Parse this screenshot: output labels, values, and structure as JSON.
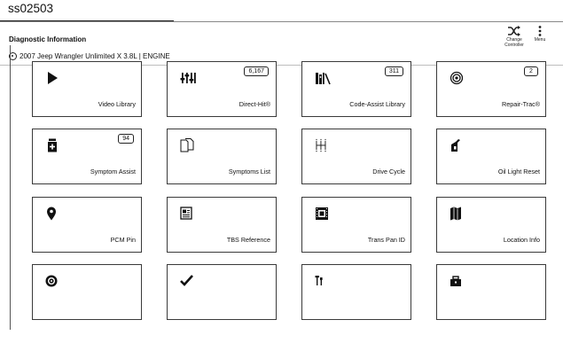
{
  "caption": "ss02503",
  "header": {
    "title": "Diagnostic Information",
    "vehicle": "2007 Jeep Wrangler Unlimited X 3.8L | ENGINE",
    "change_controller_line1": "Change",
    "change_controller_line2": "Controller",
    "menu_label": "Menu"
  },
  "tiles": [
    {
      "label": "Video Library",
      "icon": "play-icon",
      "badge": null
    },
    {
      "label": "Direct-Hit®",
      "icon": "sliders-icon",
      "badge": "6,167"
    },
    {
      "label": "Code-Assist Library",
      "icon": "library-books-icon",
      "badge": "311"
    },
    {
      "label": "Repair-Trac®",
      "icon": "target-icon",
      "badge": "2"
    },
    {
      "label": "Symptom Assist",
      "icon": "medicine-bottle-icon",
      "badge": "94"
    },
    {
      "label": "Symptoms List",
      "icon": "documents-icon",
      "badge": null
    },
    {
      "label": "Drive Cycle",
      "icon": "gear-shift-icon",
      "badge": null
    },
    {
      "label": "Oil Light Reset",
      "icon": "oil-can-icon",
      "badge": null
    },
    {
      "label": "PCM Pin",
      "icon": "map-pin-icon",
      "badge": null
    },
    {
      "label": "TBS Reference",
      "icon": "newspaper-icon",
      "badge": null
    },
    {
      "label": "Trans Pan ID",
      "icon": "film-frame-icon",
      "badge": null
    },
    {
      "label": "Location Info",
      "icon": "map-icon",
      "badge": null
    },
    {
      "label": "",
      "icon": "wheel-icon",
      "badge": null
    },
    {
      "label": "",
      "icon": "checkmark-icon",
      "badge": null
    },
    {
      "label": "",
      "icon": "tools-icon",
      "badge": null
    },
    {
      "label": "",
      "icon": "toolbox-icon",
      "badge": null
    }
  ]
}
